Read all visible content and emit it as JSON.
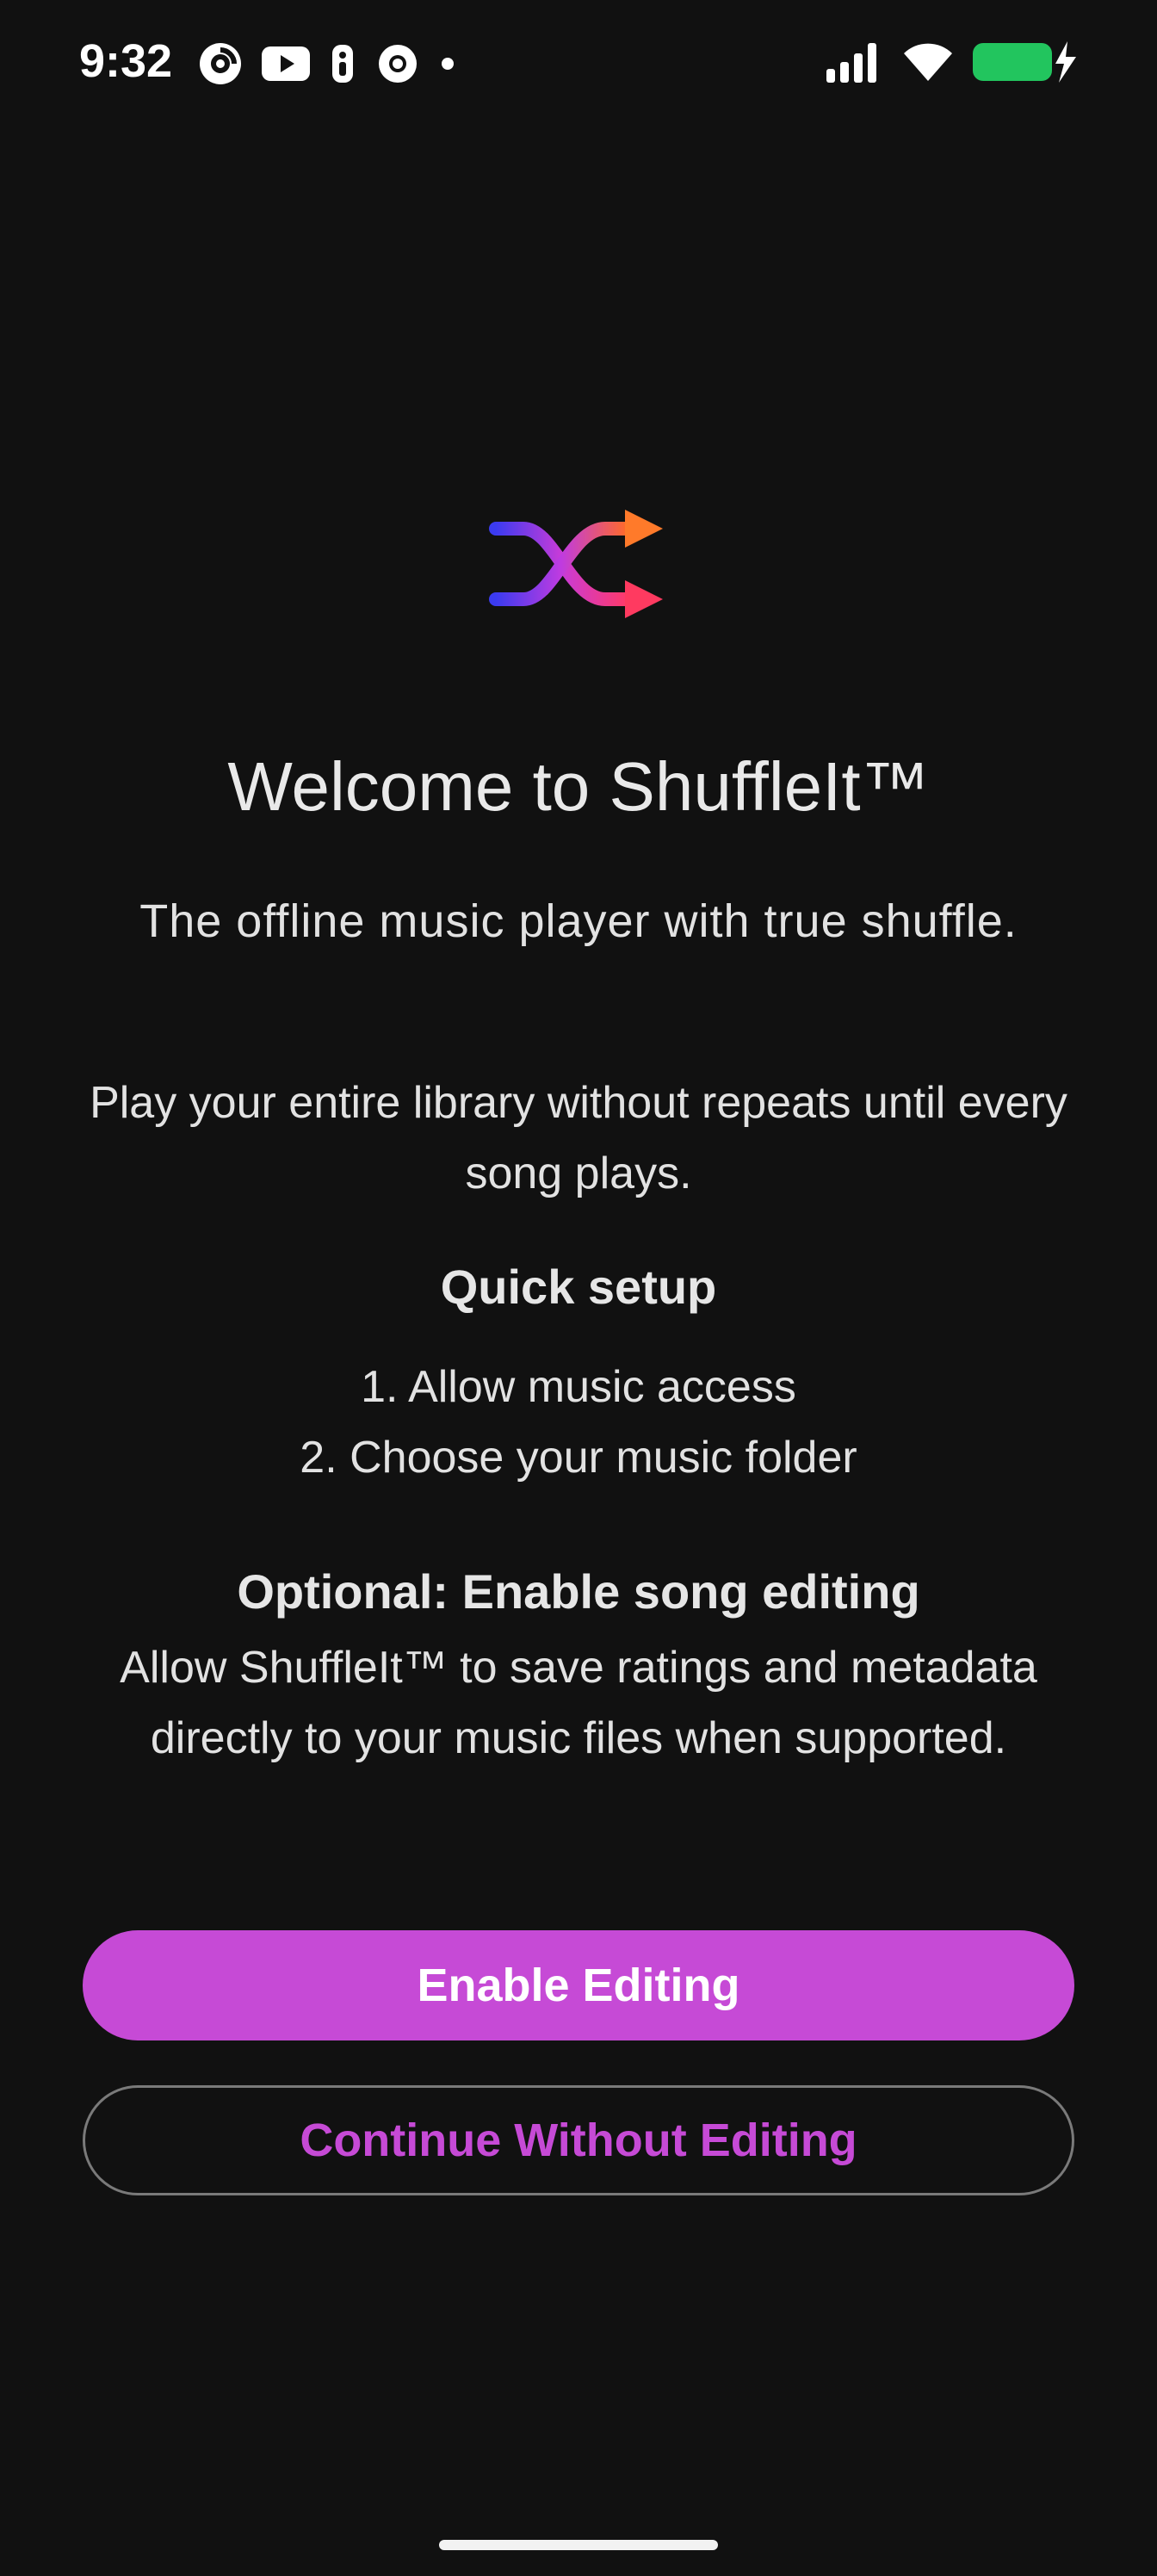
{
  "status_bar": {
    "time": "9:32",
    "notification_icons": [
      "threads-icon",
      "youtube-icon",
      "accessibility-icon",
      "chrome-icon",
      "dot-icon"
    ],
    "system_icons": [
      "signal-icon",
      "wifi-icon",
      "battery-charging-icon"
    ],
    "battery_color": "#22c55e"
  },
  "logo": {
    "icon": "shuffle-icon"
  },
  "welcome": {
    "title": "Welcome to ShuffleIt™",
    "tagline": "The offline music player with true shuffle.",
    "description": "Play your entire library without repeats until every song plays."
  },
  "setup": {
    "title": "Quick setup",
    "steps": [
      "1. Allow music access",
      "2. Choose your music folder"
    ]
  },
  "optional": {
    "title": "Optional: Enable song editing",
    "description": "Allow ShuffleIt™ to save ratings and metadata directly to your music files when supported."
  },
  "buttons": {
    "enable_editing": "Enable Editing",
    "continue_without": "Continue Without Editing"
  },
  "colors": {
    "accent": "#c64ad6",
    "background": "#111111"
  }
}
